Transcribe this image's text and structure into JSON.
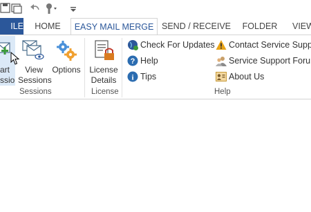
{
  "qat": {
    "icons": [
      "save-icon",
      "folder-icon",
      "undo-icon",
      "touch-mode-icon",
      "customize-toolbar-icon"
    ]
  },
  "tabs": {
    "file": "ILE",
    "home": "HOME",
    "easy_mail_merge": "EASY MAIL MERGE",
    "send_receive": "SEND / RECEIVE",
    "folder": "FOLDER",
    "view": "VIEW"
  },
  "ribbon": {
    "sessions": {
      "label": "Sessions",
      "start_session": {
        "line1": "art",
        "line2": "ssion"
      },
      "view_sessions": {
        "line1": "View",
        "line2": "Sessions"
      },
      "options": "Options"
    },
    "license": {
      "label": "License",
      "license_details": {
        "line1": "License",
        "line2": "Details"
      }
    },
    "help": {
      "label": "Help",
      "check_updates": "Check For Updates",
      "help": "Help",
      "tips": "Tips",
      "contact_support": "Contact Service Support",
      "support_forum": "Service Support Forum",
      "about_us": "About Us"
    }
  },
  "colors": {
    "file_tab": "#2b579a",
    "accent": "#2b579a",
    "warning": "#e8a317",
    "options_gear": "#f0a030"
  }
}
